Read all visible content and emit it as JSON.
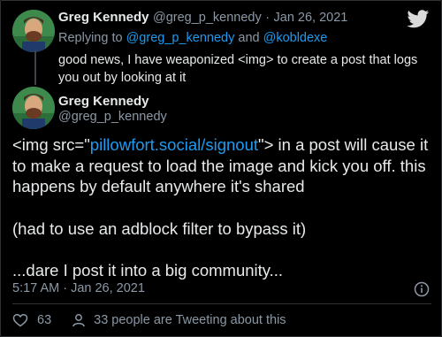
{
  "reply_tweet": {
    "author_name": "Greg Kennedy",
    "author_handle": "@greg_p_kennedy",
    "separator": "·",
    "date": "Jan 26, 2021",
    "replying_prefix": "Replying to",
    "replying_handle_1": "@greg_p_kennedy",
    "replying_and": "and",
    "replying_handle_2": "@kobldexe",
    "text": "good news, I have weaponized <img> to create a post that logs you out by looking at it"
  },
  "main_tweet": {
    "author_name": "Greg Kennedy",
    "author_handle": "@greg_p_kennedy",
    "text_part1": "<img src=\"",
    "link_text": "pillowfort.social/signout",
    "text_part2": "\"> in a post will cause it to make a request to load the image and kick you off.  this happens by default anywhere it's shared",
    "paragraph2": "(had to use an adblock filter to bypass it)",
    "paragraph3": "...dare I post it into a big community...",
    "timestamp": "5:17 AM · Jan 26, 2021"
  },
  "footer": {
    "like_count": "63",
    "tweeting_text": "33 people are Tweeting about this"
  },
  "colors": {
    "background": "#000000",
    "text": "#e7e9ea",
    "muted": "#8b98a5",
    "link": "#1d9bf0"
  },
  "icons": [
    "twitter-bird-icon",
    "info-icon",
    "heart-icon",
    "person-icon"
  ]
}
